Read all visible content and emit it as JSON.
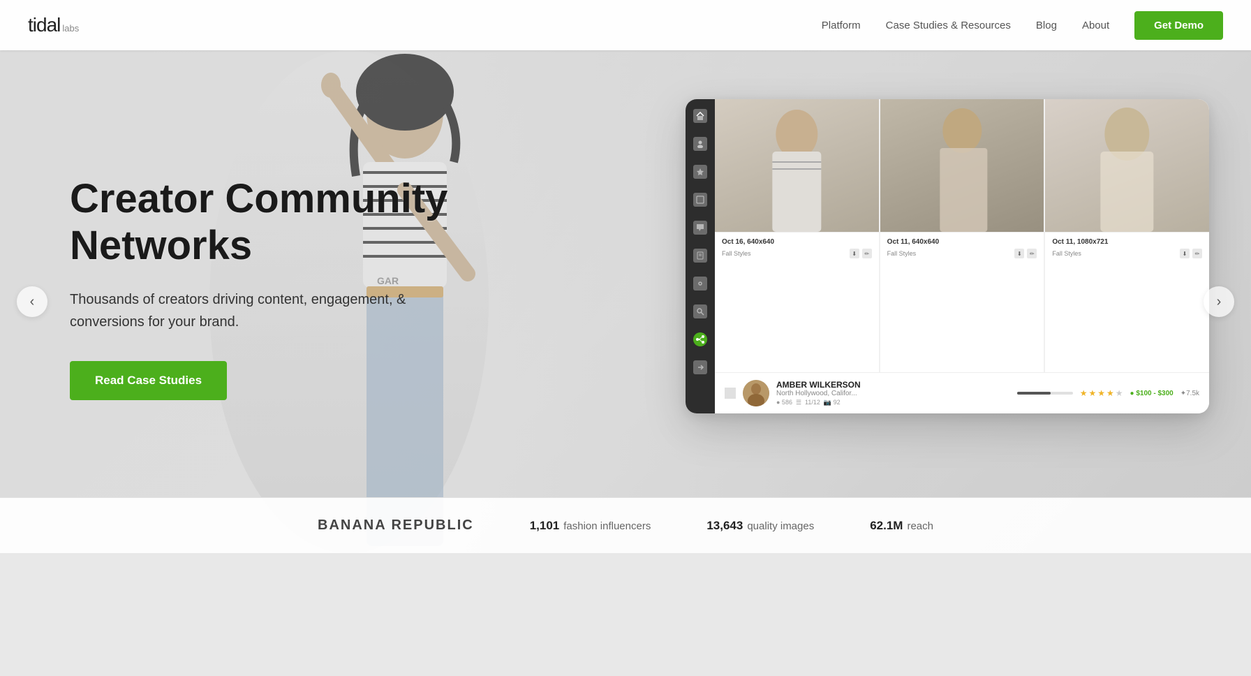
{
  "logo": {
    "tidal": "tidal",
    "labs": "labs"
  },
  "nav": {
    "links": [
      {
        "id": "platform",
        "label": "Platform"
      },
      {
        "id": "case-studies-resources",
        "label": "Case Studies & Resources"
      },
      {
        "id": "blog",
        "label": "Blog"
      },
      {
        "id": "about",
        "label": "About"
      }
    ],
    "cta_label": "Get Demo"
  },
  "hero": {
    "title": "Creator Community Networks",
    "subtitle": "Thousands of creators driving content, engagement, & conversions for your brand.",
    "cta_label": "Read Case Studies"
  },
  "app": {
    "images": [
      {
        "date": "Oct 16, 640x640",
        "tag": "Fall Styles"
      },
      {
        "date": "Oct 11, 640x640",
        "tag": "Fall Styles"
      },
      {
        "date": "Oct 11, 1080x721",
        "tag": "Fall Styles"
      }
    ],
    "creator": {
      "name": "AMBER WILKERSON",
      "location": "North Hollywood, Califor...",
      "stats": "586  ☰  11/12  📷 92",
      "price": "● $100 - $300",
      "score": "✦7.5k"
    }
  },
  "nav_arrows": {
    "left": "‹",
    "right": "›"
  },
  "stats": {
    "brand": "BANANA REPUBLIC",
    "items": [
      {
        "number": "1,101",
        "label": "fashion influencers"
      },
      {
        "number": "13,643",
        "label": "quality images"
      },
      {
        "number": "62.1M",
        "label": "reach"
      }
    ]
  }
}
